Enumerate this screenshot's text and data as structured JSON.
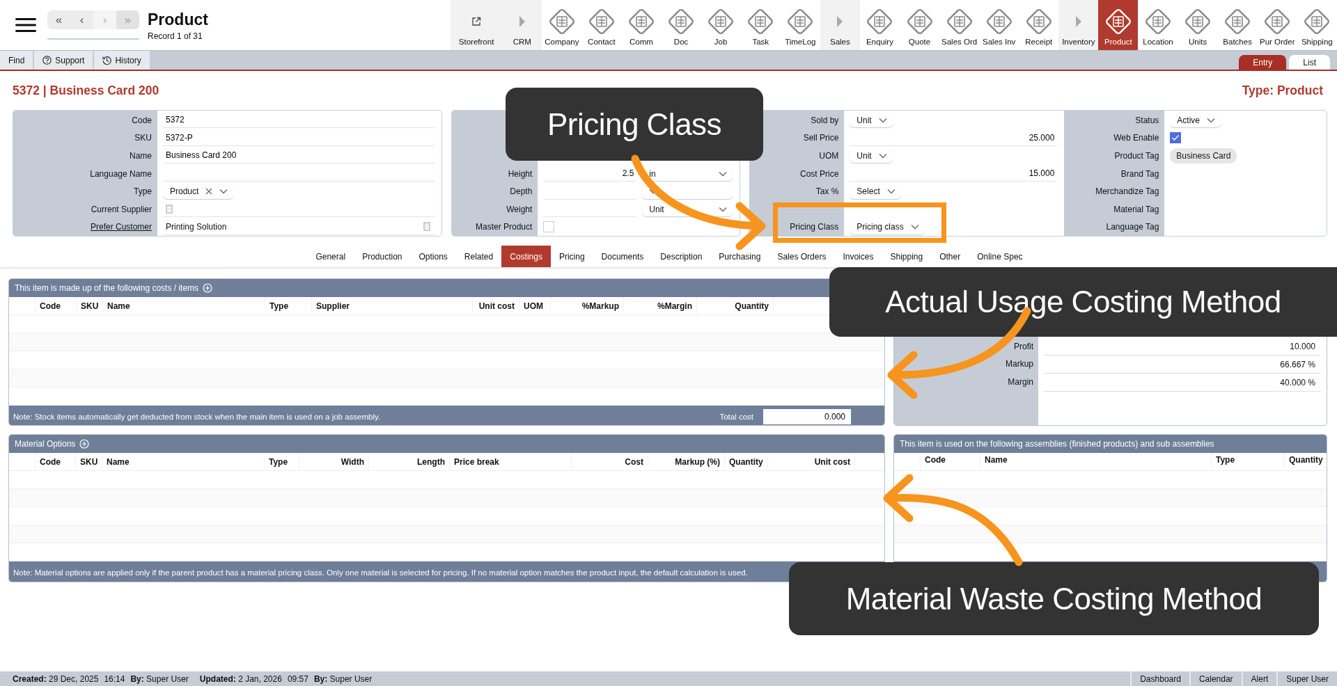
{
  "header": {
    "title": "Product",
    "record": "Record 1 of 31",
    "nav_buttons": [
      "«",
      "‹",
      "›",
      "»"
    ]
  },
  "modules": [
    {
      "label": "Storefront",
      "kind": "link",
      "selected": false
    },
    {
      "label": "CRM",
      "kind": "section",
      "selected": false
    },
    {
      "label": "Company",
      "kind": "module",
      "selected": false
    },
    {
      "label": "Contact",
      "kind": "module",
      "selected": false
    },
    {
      "label": "Comm",
      "kind": "module",
      "selected": false
    },
    {
      "label": "Doc",
      "kind": "module",
      "selected": false
    },
    {
      "label": "Job",
      "kind": "module",
      "selected": false
    },
    {
      "label": "Task",
      "kind": "module",
      "selected": false
    },
    {
      "label": "TimeLog",
      "kind": "module",
      "selected": false
    },
    {
      "label": "Sales",
      "kind": "section",
      "selected": false
    },
    {
      "label": "Enquiry",
      "kind": "module",
      "selected": false
    },
    {
      "label": "Quote",
      "kind": "module",
      "selected": false
    },
    {
      "label": "Sales Ord",
      "kind": "module",
      "selected": false
    },
    {
      "label": "Sales Inv",
      "kind": "module",
      "selected": false
    },
    {
      "label": "Receipt",
      "kind": "module",
      "selected": false
    },
    {
      "label": "Inventory",
      "kind": "section",
      "selected": false
    },
    {
      "label": "Product",
      "kind": "module",
      "selected": true
    },
    {
      "label": "Location",
      "kind": "module",
      "selected": false
    },
    {
      "label": "Units",
      "kind": "module",
      "selected": false
    },
    {
      "label": "Batches",
      "kind": "module",
      "selected": false
    },
    {
      "label": "Pur Order",
      "kind": "module",
      "selected": false
    },
    {
      "label": "Shipping",
      "kind": "module",
      "selected": false
    }
  ],
  "toolbar": [
    {
      "label": "Find",
      "kind": "plain"
    },
    {
      "label": "Support",
      "kind": "help"
    },
    {
      "label": "History",
      "kind": "history"
    }
  ],
  "view_tabs": [
    {
      "label": "Entry",
      "selected": true
    },
    {
      "label": "List",
      "selected": false
    }
  ],
  "record_title": "5372 | Business Card 200",
  "record_type": "Type: Product",
  "panels": [
    {
      "columns": [
        [
          {
            "label": "Code",
            "kind": "text",
            "value": "5372",
            "label_link": false
          },
          {
            "label": "SKU",
            "kind": "text",
            "value": "5372-P",
            "label_link": false
          },
          {
            "label": "Name",
            "kind": "text",
            "value": "Business Card 200",
            "label_link": false
          },
          {
            "label": "Language Name",
            "kind": "text",
            "label_link": false
          },
          {
            "label": "Type",
            "kind": "select_clear",
            "value": "Product",
            "label_link": false
          },
          {
            "label": "Current Supplier",
            "kind": "lookup",
            "label_link": false
          },
          {
            "label": "Prefer Customer",
            "kind": "lookup",
            "value": "Printing Solution",
            "label_link": true
          }
        ]
      ]
    },
    {
      "columns": [
        [
          {
            "kind": "blank"
          },
          {
            "kind": "blank"
          },
          {
            "kind": "blank"
          },
          {
            "label": "Height",
            "kind": "dim",
            "value": "2.5",
            "unit": "in"
          },
          {
            "label": "Depth",
            "kind": "dim"
          },
          {
            "label": "Weight",
            "kind": "dim",
            "unit": "Unit"
          },
          {
            "label": "Master Product",
            "kind": "checkbox",
            "checked": false
          }
        ]
      ]
    },
    {
      "columns": [
        [
          {
            "label": "Sold by",
            "kind": "select",
            "value": "Unit"
          },
          {
            "label": "Sell Price",
            "kind": "number",
            "value": "25.000"
          },
          {
            "label": "UOM",
            "kind": "select",
            "value": "Unit"
          },
          {
            "label": "Cost Price",
            "kind": "number",
            "value": "15.000"
          },
          {
            "label": "Tax %",
            "kind": "select",
            "value": "Select"
          },
          {
            "kind": "blank"
          },
          {
            "label": "Pricing Class",
            "kind": "select",
            "value": "Pricing class"
          }
        ],
        [
          {
            "label": "Status",
            "kind": "select",
            "value": "Active"
          },
          {
            "label": "Web Enable",
            "kind": "checkbox",
            "checked": true
          },
          {
            "label": "Product Tag",
            "kind": "tag",
            "value": "Business Card"
          },
          {
            "label": "Brand Tag",
            "kind": "blank"
          },
          {
            "label": "Merchandize Tag",
            "kind": "blank"
          },
          {
            "label": "Material Tag",
            "kind": "blank"
          },
          {
            "label": "Language Tag",
            "kind": "blank"
          }
        ]
      ]
    }
  ],
  "detail_tabs": [
    {
      "label": "General",
      "selected": false
    },
    {
      "label": "Production",
      "selected": false
    },
    {
      "label": "Options",
      "selected": false
    },
    {
      "label": "Related",
      "selected": false
    },
    {
      "label": "Costings",
      "selected": true
    },
    {
      "label": "Pricing",
      "selected": false
    },
    {
      "label": "Documents",
      "selected": false
    },
    {
      "label": "Description",
      "selected": false
    },
    {
      "label": "Purchasing",
      "selected": false
    },
    {
      "label": "Sales Orders",
      "selected": false
    },
    {
      "label": "Invoices",
      "selected": false
    },
    {
      "label": "Shipping",
      "selected": false
    },
    {
      "label": "Other",
      "selected": false
    },
    {
      "label": "Online Spec",
      "selected": false
    }
  ],
  "costs": {
    "title": "This item is made up of the following costs / items",
    "columns": [
      "Code",
      "SKU",
      "Name",
      "Type",
      "Supplier",
      "Unit cost",
      "UOM",
      "%Markup",
      "%Margin",
      "Quantity"
    ],
    "note": "Note: Stock items automatically get deducted from stock when the main item is used on a job assembly.",
    "total_label": "Total cost",
    "total": "0.000"
  },
  "pricing_summary": {
    "rows": [
      {
        "label": "Profit",
        "value": "10.000"
      },
      {
        "label": "Markup",
        "value": "66.667 %"
      },
      {
        "label": "Margin",
        "value": "40.000 %"
      }
    ]
  },
  "materials": {
    "title": "Material Options",
    "columns": [
      "Code",
      "SKU",
      "Name",
      "Type",
      "Width",
      "Length",
      "Price break",
      "Cost",
      "Markup (%)",
      "Quantity",
      "Unit cost"
    ],
    "note": "Note: Material options are applied only if the parent product has a material pricing class. Only one material is selected for pricing. If no material option matches the product input, the default calculation is used."
  },
  "assemblies": {
    "title": "This item is used on the following assemblies (finished products) and sub assemblies",
    "columns": [
      "Code",
      "Name",
      "Type",
      "Quantity"
    ]
  },
  "footer": {
    "meta": [
      "**Created:** 29 Dec, 2025",
      "16:14",
      "**By:** Super User",
      "**Updated:** 2 Jan, 2026",
      "09:57",
      "**By:** Super User"
    ],
    "links": [
      "Dashboard",
      "Calendar",
      "Alert",
      "Super User"
    ]
  },
  "callouts": [
    {
      "text": "Pricing Class"
    },
    {
      "text": "Actual Usage Costing Method"
    },
    {
      "text": "Material Waste Costing Method"
    }
  ]
}
